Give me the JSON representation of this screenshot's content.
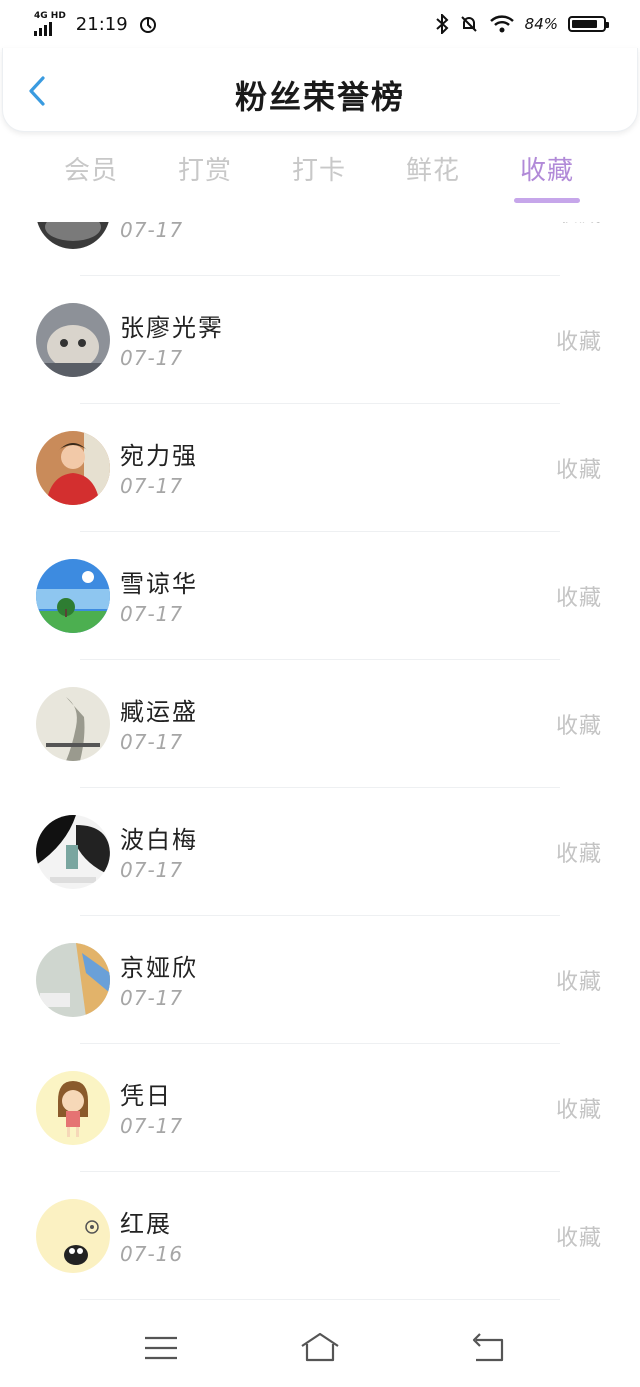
{
  "status_bar": {
    "network": "4G HD",
    "time": "21:19",
    "battery": "84%"
  },
  "header": {
    "title": "粉丝荣誉榜"
  },
  "tabs": [
    {
      "label": "会员"
    },
    {
      "label": "打赏"
    },
    {
      "label": "打卡"
    },
    {
      "label": "鲜花"
    },
    {
      "label": "收藏",
      "active": true
    }
  ],
  "list": [
    {
      "name": "",
      "date": "07-17",
      "action": "收藏"
    },
    {
      "name": "张廖光霁",
      "date": "07-17",
      "action": "收藏"
    },
    {
      "name": "宛力强",
      "date": "07-17",
      "action": "收藏"
    },
    {
      "name": "雪谅华",
      "date": "07-17",
      "action": "收藏"
    },
    {
      "name": "臧运盛",
      "date": "07-17",
      "action": "收藏"
    },
    {
      "name": "波白梅",
      "date": "07-17",
      "action": "收藏"
    },
    {
      "name": "京娅欣",
      "date": "07-17",
      "action": "收藏"
    },
    {
      "name": "凭日",
      "date": "07-17",
      "action": "收藏"
    },
    {
      "name": "红展",
      "date": "07-16",
      "action": "收藏"
    }
  ],
  "colors": {
    "accent": "#b18ad8",
    "back_arrow": "#3a9be0",
    "inactive_tab": "#c8c8c8"
  },
  "icons": {
    "back": "chevron-left-icon",
    "nav": [
      "menu-icon",
      "home-icon",
      "back-icon"
    ]
  }
}
